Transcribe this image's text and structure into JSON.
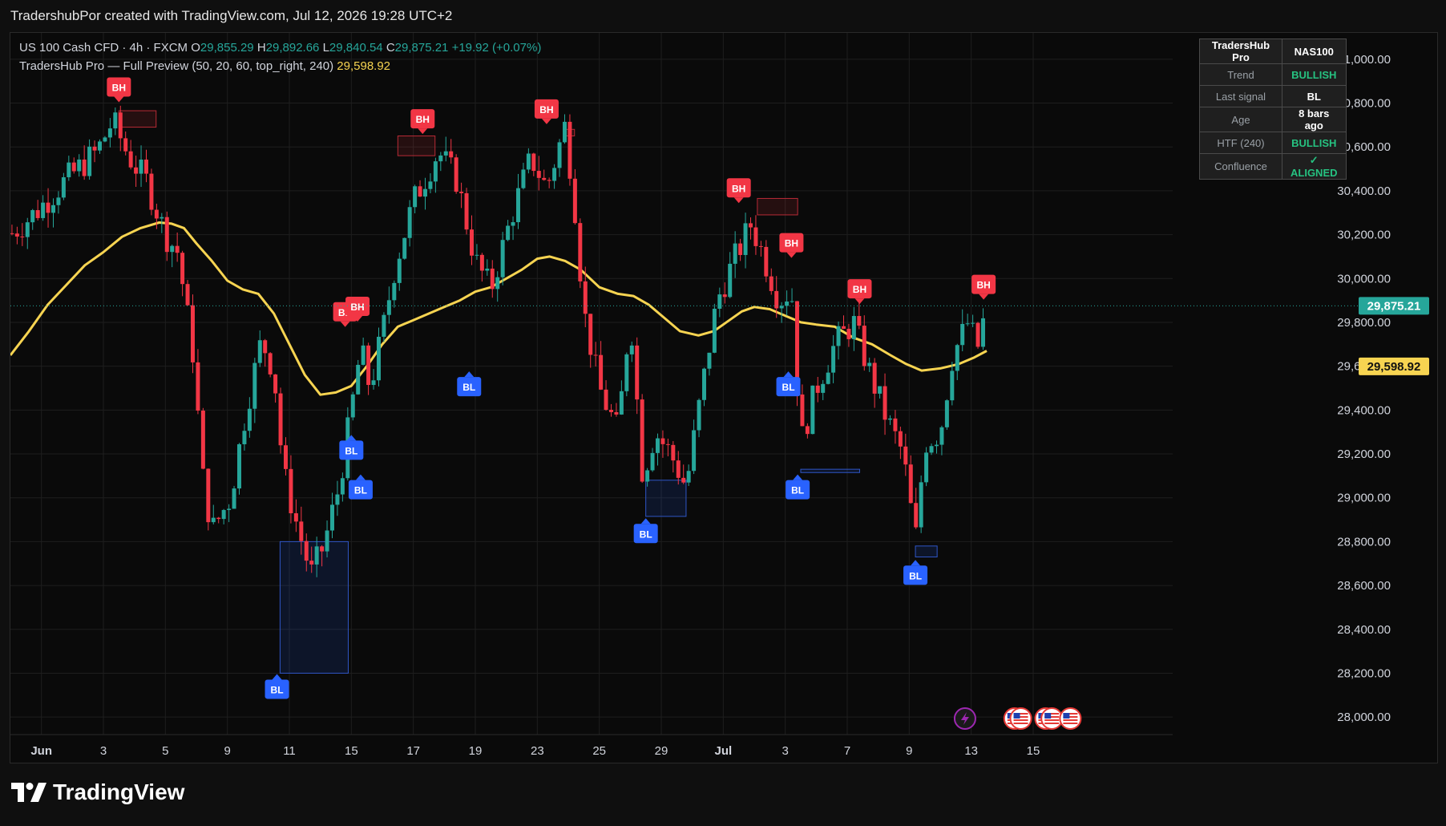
{
  "header": {
    "text": "TradershubPor created with TradingView.com, Jul 12, 2026 19:28 UTC+2"
  },
  "legend": {
    "symbol": "US 100 Cash CFD · 4h · FXCM",
    "o_label": "O",
    "o_value": "29,855.29",
    "h_label": "H",
    "h_value": "29,892.66",
    "l_label": "L",
    "l_value": "29,840.54",
    "c_label": "C",
    "c_value": "29,875.21",
    "change": "+19.92 (+0.07%)",
    "indicator": "TradersHub Pro — Full Preview (50, 20, 60, top_right, 240)",
    "indicator_value": "29,598.92"
  },
  "info_table": {
    "header": [
      "TradersHub Pro",
      "NAS100"
    ],
    "rows": [
      {
        "label": "Trend",
        "value": "BULLISH",
        "color": "#26c281"
      },
      {
        "label": "Last signal",
        "value": "BL",
        "color": "#ffffff"
      },
      {
        "label": "Age",
        "value": "8 bars ago",
        "color": "#ffffff"
      },
      {
        "label": "HTF (240)",
        "value": "BULLISH",
        "color": "#26c281"
      },
      {
        "label": "Confluence",
        "value": "✓ ALIGNED",
        "color": "#26c281"
      }
    ]
  },
  "brand": {
    "name": "TradingView",
    "icon": "tradingview-logo-icon"
  },
  "colors": {
    "up": "#26a69a",
    "down": "#f23645",
    "ma": "#f7d451",
    "bh": "#f23645",
    "bl": "#2962ff",
    "grid": "#1e1e1e",
    "axis_text": "#d1d4dc"
  },
  "chart_data": {
    "type": "candlestick",
    "y_ticks": [
      28000,
      28200,
      28400,
      28600,
      28800,
      29000,
      29200,
      29400,
      29600,
      29800,
      30000,
      30200,
      30400,
      30600,
      30800,
      31000
    ],
    "y_tick_labels": [
      "28,000.00",
      "28,200.00",
      "28,400.00",
      "28,600.00",
      "28,800.00",
      "29,000.00",
      "29,200.00",
      "29,400.00",
      "29,600.00",
      "29,800.00",
      "30,000.00",
      "30,200.00",
      "30,400.00",
      "30,600.00",
      "30,800.00",
      "31,000.00"
    ],
    "ylim": [
      27920,
      31120
    ],
    "x_ticks": [
      {
        "label": "Jun",
        "day": 0
      },
      {
        "label": "3",
        "day": 2
      },
      {
        "label": "5",
        "day": 4
      },
      {
        "label": "9",
        "day": 6
      },
      {
        "label": "11",
        "day": 8
      },
      {
        "label": "15",
        "day": 10
      },
      {
        "label": "17",
        "day": 12
      },
      {
        "label": "19",
        "day": 14
      },
      {
        "label": "23",
        "day": 16
      },
      {
        "label": "25",
        "day": 18
      },
      {
        "label": "29",
        "day": 20
      },
      {
        "label": "Jul",
        "day": 22
      },
      {
        "label": "3",
        "day": 24
      },
      {
        "label": "7",
        "day": 26
      },
      {
        "label": "9",
        "day": 28
      },
      {
        "label": "13",
        "day": 30
      },
      {
        "label": "15",
        "day": 32
      }
    ],
    "xlim": [
      -1,
      36.5
    ],
    "last_price": 29875.21,
    "last_price_label": "29,875.21",
    "ma_value": 29598.92,
    "ma_value_label": "29,598.92",
    "close_path": [
      [
        -1,
        30200
      ],
      [
        -0.2,
        30300
      ],
      [
        0.8,
        30450
      ],
      [
        1.8,
        30580
      ],
      [
        2.3,
        30720
      ],
      [
        2.8,
        30560
      ],
      [
        3.4,
        30440
      ],
      [
        4.0,
        30200
      ],
      [
        4.4,
        30120
      ],
      [
        4.9,
        29650
      ],
      [
        5.2,
        29100
      ],
      [
        5.5,
        28850
      ],
      [
        6.1,
        29000
      ],
      [
        6.6,
        29400
      ],
      [
        7.1,
        29720
      ],
      [
        7.5,
        29580
      ],
      [
        7.8,
        29120
      ],
      [
        8.2,
        28900
      ],
      [
        8.7,
        28650
      ],
      [
        9.1,
        28780
      ],
      [
        9.6,
        29050
      ],
      [
        10.0,
        29400
      ],
      [
        10.3,
        29680
      ],
      [
        10.6,
        29500
      ],
      [
        11.0,
        29750
      ],
      [
        11.4,
        30050
      ],
      [
        12.0,
        30350
      ],
      [
        12.8,
        30580
      ],
      [
        13.4,
        30450
      ],
      [
        14.0,
        30080
      ],
      [
        14.5,
        29950
      ],
      [
        15.2,
        30300
      ],
      [
        15.8,
        30550
      ],
      [
        16.3,
        30410
      ],
      [
        16.9,
        30700
      ],
      [
        17.2,
        30350
      ],
      [
        17.5,
        29850
      ],
      [
        18.0,
        29500
      ],
      [
        18.6,
        29300
      ],
      [
        19.0,
        29850
      ],
      [
        19.4,
        29100
      ],
      [
        19.8,
        29300
      ],
      [
        20.3,
        29200
      ],
      [
        20.8,
        29050
      ],
      [
        21.2,
        29400
      ],
      [
        21.8,
        29900
      ],
      [
        22.4,
        30100
      ],
      [
        22.9,
        30250
      ],
      [
        23.3,
        30100
      ],
      [
        23.8,
        29900
      ],
      [
        24.2,
        29950
      ],
      [
        24.5,
        29250
      ],
      [
        25.0,
        29500
      ],
      [
        25.6,
        29700
      ],
      [
        26.2,
        29800
      ],
      [
        26.7,
        29580
      ],
      [
        27.3,
        29350
      ],
      [
        27.8,
        29200
      ],
      [
        28.2,
        28800
      ],
      [
        28.5,
        29250
      ],
      [
        29.0,
        29300
      ],
      [
        29.4,
        29650
      ],
      [
        29.9,
        29800
      ],
      [
        30.2,
        29680
      ],
      [
        30.5,
        29875
      ]
    ],
    "ma_path": [
      [
        -1,
        29650
      ],
      [
        -0.4,
        29760
      ],
      [
        0.2,
        29880
      ],
      [
        0.8,
        29970
      ],
      [
        1.4,
        30060
      ],
      [
        2.0,
        30120
      ],
      [
        2.6,
        30190
      ],
      [
        3.2,
        30230
      ],
      [
        3.8,
        30255
      ],
      [
        4.2,
        30250
      ],
      [
        4.6,
        30230
      ],
      [
        5.0,
        30160
      ],
      [
        5.5,
        30080
      ],
      [
        6.0,
        29990
      ],
      [
        6.5,
        29950
      ],
      [
        7.0,
        29930
      ],
      [
        7.5,
        29840
      ],
      [
        8.0,
        29700
      ],
      [
        8.5,
        29560
      ],
      [
        9.0,
        29470
      ],
      [
        9.5,
        29480
      ],
      [
        10.0,
        29510
      ],
      [
        10.5,
        29600
      ],
      [
        11.0,
        29700
      ],
      [
        11.5,
        29780
      ],
      [
        12.0,
        29810
      ],
      [
        12.5,
        29840
      ],
      [
        13.0,
        29870
      ],
      [
        13.5,
        29900
      ],
      [
        14.0,
        29940
      ],
      [
        14.5,
        29960
      ],
      [
        15.0,
        30000
      ],
      [
        15.5,
        30040
      ],
      [
        16.0,
        30090
      ],
      [
        16.4,
        30100
      ],
      [
        16.9,
        30080
      ],
      [
        17.4,
        30040
      ],
      [
        18.0,
        29960
      ],
      [
        18.6,
        29930
      ],
      [
        19.1,
        29920
      ],
      [
        19.6,
        29880
      ],
      [
        20.1,
        29820
      ],
      [
        20.6,
        29760
      ],
      [
        21.2,
        29740
      ],
      [
        21.7,
        29760
      ],
      [
        22.2,
        29810
      ],
      [
        22.6,
        29850
      ],
      [
        23.0,
        29870
      ],
      [
        23.5,
        29860
      ],
      [
        24.0,
        29830
      ],
      [
        24.5,
        29800
      ],
      [
        25.0,
        29790
      ],
      [
        25.6,
        29780
      ],
      [
        26.2,
        29730
      ],
      [
        26.8,
        29700
      ],
      [
        27.4,
        29650
      ],
      [
        27.9,
        29610
      ],
      [
        28.4,
        29580
      ],
      [
        29.0,
        29590
      ],
      [
        29.6,
        29610
      ],
      [
        30.1,
        29640
      ],
      [
        30.5,
        29670
      ]
    ],
    "zones": [
      {
        "kind": "bh",
        "x0": 2.5,
        "x1": 3.7,
        "y0": 30690,
        "y1": 30765
      },
      {
        "kind": "bh",
        "x0": 11.5,
        "x1": 12.7,
        "y0": 30560,
        "y1": 30650
      },
      {
        "kind": "bh",
        "x0": 16.9,
        "x1": 17.2,
        "y0": 30650,
        "y1": 30680
      },
      {
        "kind": "bh",
        "x0": 23.1,
        "x1": 24.4,
        "y0": 30290,
        "y1": 30365
      },
      {
        "kind": "bl",
        "x0": 7.7,
        "x1": 9.9,
        "y0": 28200,
        "y1": 28800
      },
      {
        "kind": "bl",
        "x0": 19.5,
        "x1": 20.8,
        "y0": 28915,
        "y1": 29080
      },
      {
        "kind": "bl",
        "x0": 24.5,
        "x1": 26.4,
        "y0": 29115,
        "y1": 29130
      },
      {
        "kind": "bl",
        "x0": 28.2,
        "x1": 28.9,
        "y0": 28730,
        "y1": 28780
      }
    ],
    "signals": [
      {
        "kind": "BH",
        "day": 2.5,
        "price": 30800
      },
      {
        "kind": "BH",
        "day": 9.8,
        "price": 29775
      },
      {
        "kind": "BH",
        "day": 10.2,
        "price": 29800
      },
      {
        "kind": "BH",
        "day": 12.3,
        "price": 30655
      },
      {
        "kind": "BH",
        "day": 16.3,
        "price": 30700
      },
      {
        "kind": "BH",
        "day": 22.5,
        "price": 30340
      },
      {
        "kind": "BH",
        "day": 24.2,
        "price": 30090
      },
      {
        "kind": "BH",
        "day": 26.4,
        "price": 29880
      },
      {
        "kind": "BH",
        "day": 30.4,
        "price": 29900
      },
      {
        "kind": "BL",
        "day": 7.6,
        "price": 28200
      },
      {
        "kind": "BL",
        "day": 10.0,
        "price": 29290
      },
      {
        "kind": "BL",
        "day": 10.3,
        "price": 29110
      },
      {
        "kind": "BL",
        "day": 13.8,
        "price": 29580
      },
      {
        "kind": "BL",
        "day": 19.5,
        "price": 28910
      },
      {
        "kind": "BL",
        "day": 24.1,
        "price": 29580
      },
      {
        "kind": "BL",
        "day": 24.4,
        "price": 29110
      },
      {
        "kind": "BL",
        "day": 28.2,
        "price": 28720
      }
    ],
    "event_icons": [
      {
        "name": "lightning-icon",
        "day": 29.8
      },
      {
        "name": "us-flag-icon",
        "day": 31.4
      },
      {
        "name": "us-flag-icon",
        "day": 31.6
      },
      {
        "name": "us-flag-icon",
        "day": 32.4
      },
      {
        "name": "us-flag-icon",
        "day": 32.6
      },
      {
        "name": "us-flag-icon",
        "day": 33.2
      }
    ]
  }
}
